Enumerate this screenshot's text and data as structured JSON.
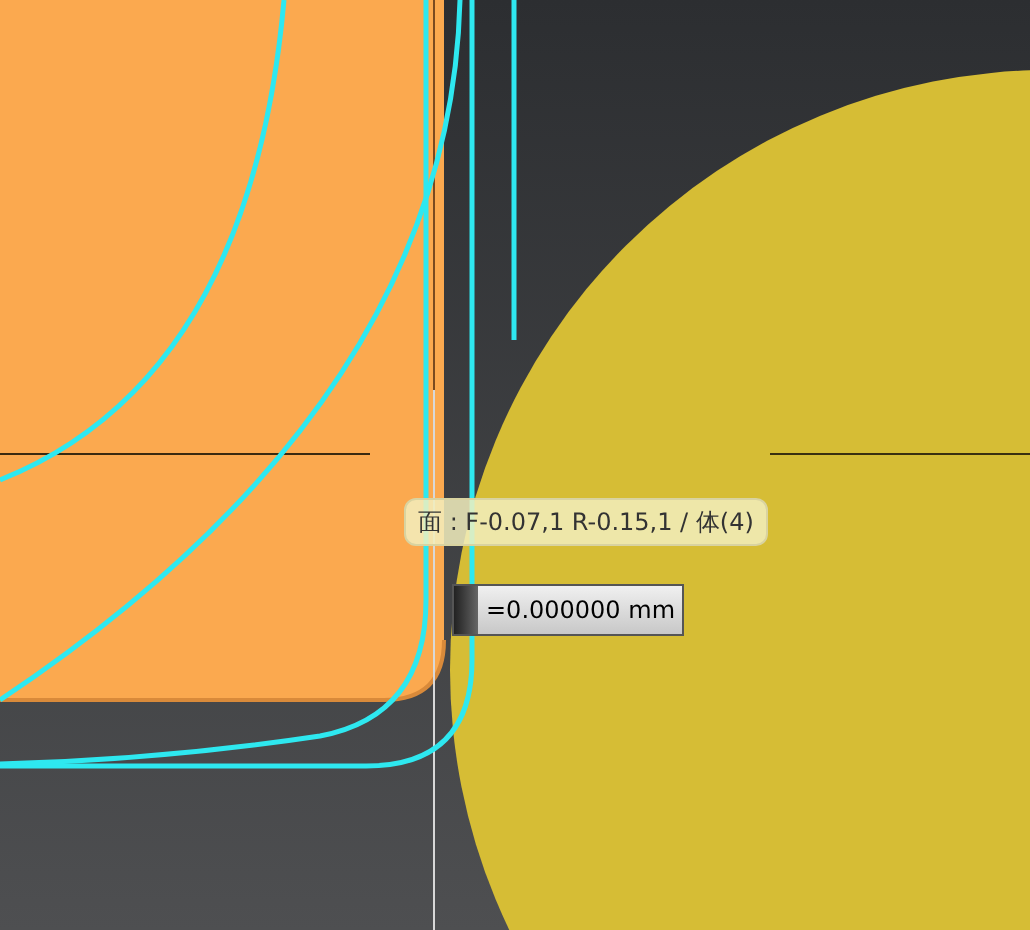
{
  "tooltip": {
    "text": "面 : F-0.07,1 R-0.15,1 / 体(4)"
  },
  "dimension_input": {
    "value": "=0.000000 mm"
  }
}
